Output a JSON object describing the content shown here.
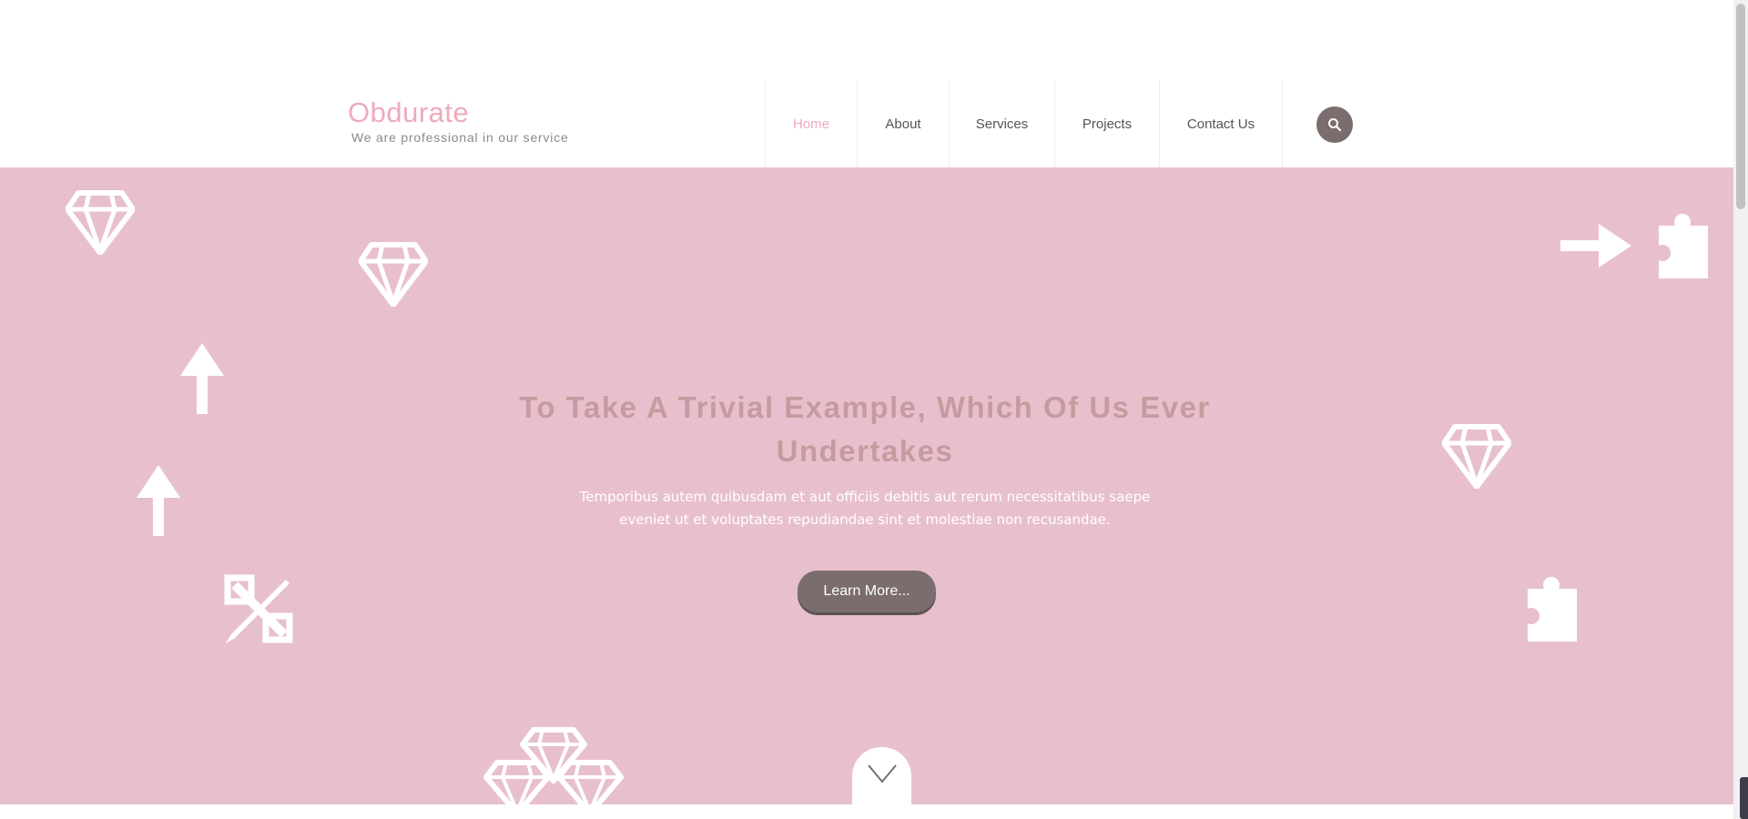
{
  "brand": {
    "title": "Obdurate",
    "tagline": "We are professional in our service"
  },
  "nav": {
    "items": [
      {
        "label": "Home",
        "active": true
      },
      {
        "label": "About",
        "active": false
      },
      {
        "label": "Services",
        "active": false
      },
      {
        "label": "Projects",
        "active": false
      },
      {
        "label": "Contact Us",
        "active": false
      }
    ],
    "search_icon": "search-icon"
  },
  "hero": {
    "title": "To Take A Trivial Example, Which Of Us Ever Undertakes",
    "text": "Temporibus autem quibusdam et aut officiis debitis aut rerum necessitatibus saepe eveniet ut et voluptates repudiandae sint et molestiae non recusandae.",
    "button_label": "Learn More...",
    "scroll_icon": "chevron-down-icon",
    "decorative_icons": [
      "diamond-icon",
      "arrow-up-icon",
      "pencil-ruler-icon",
      "arrow-right-icon",
      "puzzle-icon"
    ]
  },
  "colors": {
    "accent": "#eeaabb",
    "hero_background": "#e8c0cd",
    "button": "#7b6d6d",
    "hero_title": "#c79a9f"
  }
}
